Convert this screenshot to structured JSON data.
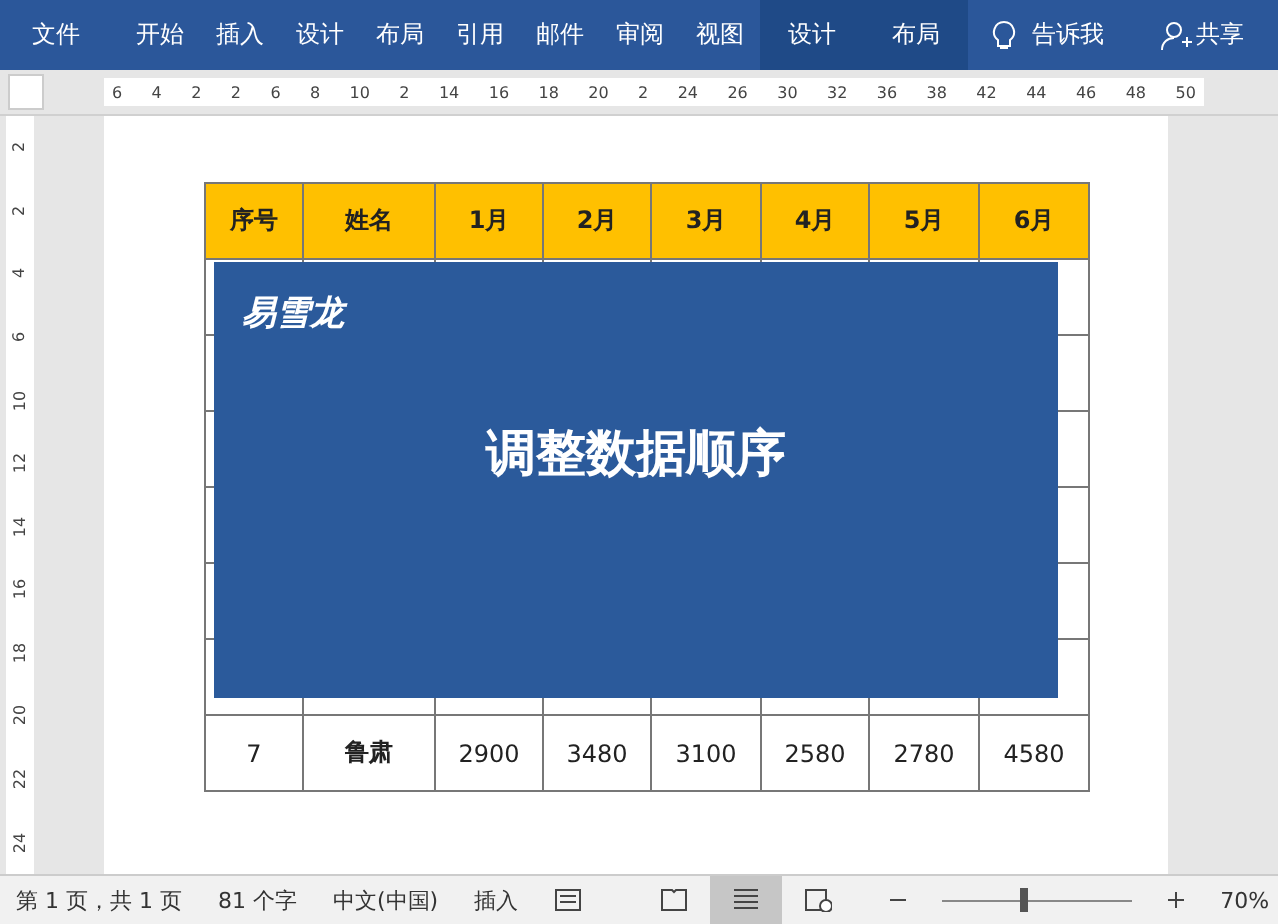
{
  "ribbon": {
    "tabs": [
      {
        "label": "文件",
        "kind": "plain"
      },
      {
        "label": "开始",
        "kind": "plain"
      },
      {
        "label": "插入",
        "kind": "plain"
      },
      {
        "label": "设计",
        "kind": "plain"
      },
      {
        "label": "布局",
        "kind": "plain"
      },
      {
        "label": "引用",
        "kind": "plain"
      },
      {
        "label": "邮件",
        "kind": "plain"
      },
      {
        "label": "审阅",
        "kind": "plain"
      },
      {
        "label": "视图",
        "kind": "plain"
      },
      {
        "label": "设计",
        "kind": "context"
      },
      {
        "label": "布局",
        "kind": "context"
      }
    ],
    "tell_me": "告诉我",
    "share": "共享"
  },
  "ruler": {
    "h_marks": [
      "6",
      "4",
      "2",
      "2",
      "6",
      "8",
      "10",
      "2",
      "14",
      "16",
      "18",
      "20",
      "2",
      "24",
      "26",
      "30",
      "32",
      "36",
      "38",
      "42",
      "44",
      "46",
      "48",
      "50"
    ],
    "v_marks": [
      "2",
      "2",
      "4",
      "6",
      "10",
      "12",
      "14",
      "16",
      "18",
      "20",
      "22",
      "24"
    ]
  },
  "table": {
    "columns": [
      "序号",
      "姓名",
      "1月",
      "2月",
      "3月",
      "4月",
      "5月",
      "6月"
    ],
    "rows": [
      [
        "7",
        "鲁肃",
        "2900",
        "3480",
        "3100",
        "2580",
        "2780",
        "4580"
      ]
    ]
  },
  "overlay": {
    "logo": "易雪龙",
    "title": "调整数据顺序"
  },
  "status_bar": {
    "page": "第 1 页，共 1 页",
    "words": "81 个字",
    "language": "中文(中国)",
    "mode": "插入",
    "zoom": {
      "level": 0.43,
      "reading": "70%"
    }
  }
}
